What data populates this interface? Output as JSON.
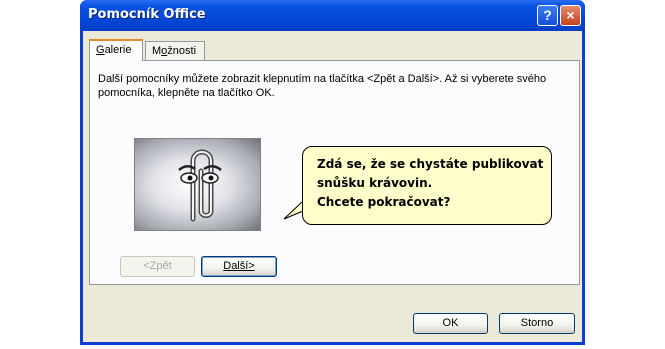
{
  "window": {
    "title": "Pomocník Office",
    "help_button": "?",
    "close_button": "×"
  },
  "tabs": [
    {
      "label": "Galerie",
      "active": true
    },
    {
      "label": "Možnosti",
      "active": false
    }
  ],
  "gallery": {
    "description": "Další pomocníky můžete zobrazit klepnutím na tlačítka <Zpět a Další>. Až si vyberete svého pomocníka, klepněte na tlačítko OK.",
    "assistant_image": "paperclip-assistant",
    "bubble_lines": [
      "Zdá se, že se chystáte publikovat",
      "snůšku krávovin.",
      "Chcete pokračovat?"
    ],
    "back_button": "<Zpět",
    "next_button": "Další>"
  },
  "footer": {
    "ok_button": "OK",
    "cancel_button": "Storno"
  },
  "colors": {
    "title_bar": "#0348d8",
    "dialog_bg": "#ece9d8",
    "bubble_bg": "#ffffcc",
    "active_tab_accent": "#e68b2c"
  }
}
